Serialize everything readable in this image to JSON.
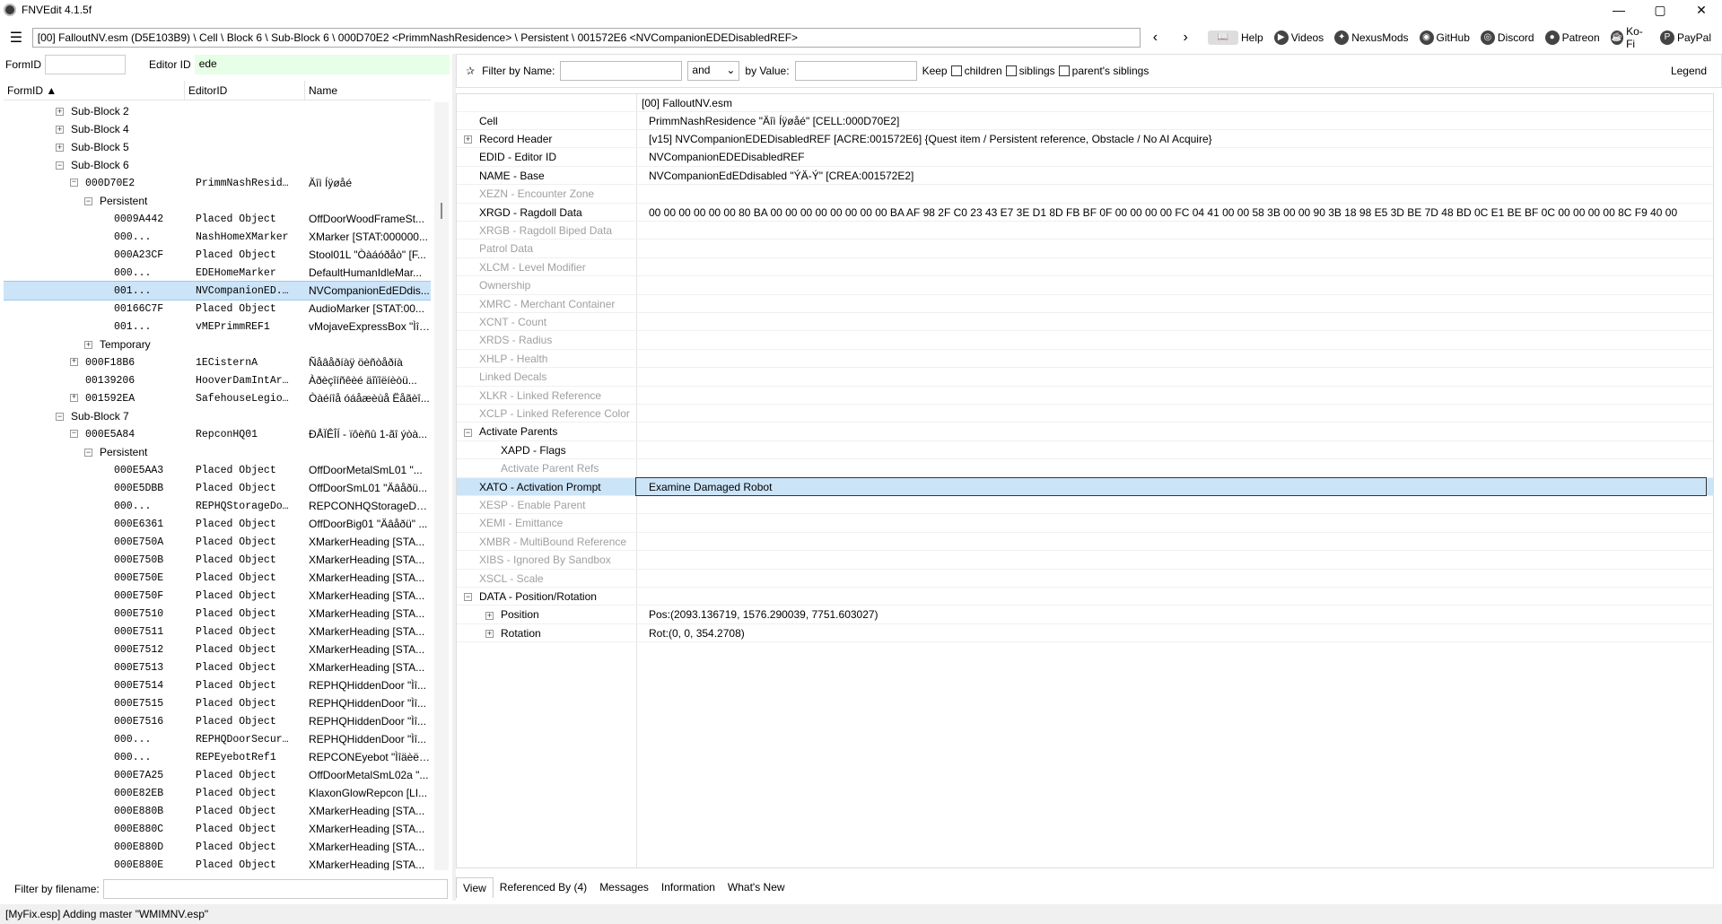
{
  "window": {
    "title": "FNVEdit 4.1.5f",
    "minimize": "—",
    "maximize": "▢",
    "close": "✕"
  },
  "toolbar": {
    "path": "[00] FalloutNV.esm (D5E103B9) \\ Cell \\ Block 6 \\ Sub-Block 6 \\ 000D70E2 <PrimmNashResidence> \\ Persistent \\ 001572E6 <NVCompanionEDEDisabledREF>",
    "back": "‹",
    "forward": "›",
    "links": [
      {
        "label": "Help",
        "icon": "book-icon"
      },
      {
        "label": "Videos",
        "icon": "videos-icon"
      },
      {
        "label": "NexusMods",
        "icon": "nexusmods-icon"
      },
      {
        "label": "GitHub",
        "icon": "github-icon"
      },
      {
        "label": "Discord",
        "icon": "discord-icon"
      },
      {
        "label": "Patreon",
        "icon": "patreon-icon"
      },
      {
        "label": "Ko-Fi",
        "icon": "kofi-icon"
      },
      {
        "label": "PayPal",
        "icon": "paypal-icon"
      }
    ]
  },
  "left": {
    "formid_label": "FormID",
    "editorid_label": "Editor ID",
    "editorid_value": "ede",
    "columns": [
      "FormID ▲",
      "EditorID",
      "Name"
    ],
    "filter_filename_label": "Filter by filename:",
    "tree": [
      {
        "indent": 0,
        "exp": "+",
        "form": "Sub-Block 2",
        "eid": "",
        "name": "",
        "mono": false
      },
      {
        "indent": 0,
        "exp": "+",
        "form": "Sub-Block 4",
        "eid": "",
        "name": "",
        "mono": false
      },
      {
        "indent": 0,
        "exp": "+",
        "form": "Sub-Block 5",
        "eid": "",
        "name": "",
        "mono": false
      },
      {
        "indent": 0,
        "exp": "−",
        "form": "Sub-Block 6",
        "eid": "",
        "name": "",
        "mono": false
      },
      {
        "indent": 1,
        "exp": "−",
        "form": "000D70E2",
        "eid": "PrimmNashReside...",
        "name": "Äîì Íÿøåé",
        "mono": true
      },
      {
        "indent": 2,
        "exp": "−",
        "form": "Persistent",
        "eid": "",
        "name": "",
        "mono": false
      },
      {
        "indent": 3,
        "exp": "",
        "form": "0009A442",
        "eid": "Placed Object",
        "name": "OffDoorWoodFrameSt...",
        "mono": true
      },
      {
        "indent": 3,
        "exp": "",
        "form": "000...",
        "eid": "NashHomeXMarker",
        "name": "XMarker [STAT:000000...",
        "mono": true
      },
      {
        "indent": 3,
        "exp": "",
        "form": "000A23CF",
        "eid": "Placed Object",
        "name": "Stool01L \"Òàáóðåò\" [F...",
        "mono": true
      },
      {
        "indent": 3,
        "exp": "",
        "form": "000...",
        "eid": "EDEHomeMarker",
        "name": "DefaultHumanIdleMar...",
        "mono": true
      },
      {
        "indent": 3,
        "exp": "",
        "form": "001...",
        "eid": "NVCompanionED...",
        "name": "NVCompanionEdEDdis...",
        "mono": true,
        "sel": true
      },
      {
        "indent": 3,
        "exp": "",
        "form": "00166C7F",
        "eid": "Placed Object",
        "name": "AudioMarker [STAT:00...",
        "mono": true
      },
      {
        "indent": 3,
        "exp": "",
        "form": "001...",
        "eid": "vMEPrimmREF1",
        "name": "vMojaveExpressBox \"Ìîõ...",
        "mono": true
      },
      {
        "indent": 2,
        "exp": "+",
        "form": "Temporary",
        "eid": "",
        "name": "",
        "mono": false
      },
      {
        "indent": 1,
        "exp": "+",
        "form": "000F18B6",
        "eid": "1ECisternA",
        "name": "Ñåâåðíàÿ öèñòåðíà",
        "mono": true
      },
      {
        "indent": 1,
        "exp": "",
        "form": "00139206",
        "eid": "HooverDamIntAriz...",
        "name": "Àðèçîíñêèé äîïîëíèòü...",
        "mono": true
      },
      {
        "indent": 1,
        "exp": "+",
        "form": "001592EA",
        "eid": "SafehouseLegionl...",
        "name": "Òàéíîå óáåæèùå Ëåãèî...",
        "mono": true
      },
      {
        "indent": 0,
        "exp": "−",
        "form": "Sub-Block 7",
        "eid": "",
        "name": "",
        "mono": false
      },
      {
        "indent": 1,
        "exp": "−",
        "form": "000E5A84",
        "eid": "RepconHQ01",
        "name": "ÐÅÏÊÎÍ - ïôèñû 1-ãî ýòà...",
        "mono": true
      },
      {
        "indent": 2,
        "exp": "−",
        "form": "Persistent",
        "eid": "",
        "name": "",
        "mono": false
      },
      {
        "indent": 3,
        "exp": "",
        "form": "000E5AA3",
        "eid": "Placed Object",
        "name": "OffDoorMetalSmL01 \"...",
        "mono": true
      },
      {
        "indent": 3,
        "exp": "",
        "form": "000E5DBB",
        "eid": "Placed Object",
        "name": "OffDoorSmL01 \"Äâåðü...",
        "mono": true
      },
      {
        "indent": 3,
        "exp": "",
        "form": "000...",
        "eid": "REPHQStorageDoor",
        "name": "REPCONHQStorageDo...",
        "mono": true
      },
      {
        "indent": 3,
        "exp": "",
        "form": "000E6361",
        "eid": "Placed Object",
        "name": "OffDoorBig01 \"Äâåðü\" ...",
        "mono": true
      },
      {
        "indent": 3,
        "exp": "",
        "form": "000E750A",
        "eid": "Placed Object",
        "name": "XMarkerHeading [STA...",
        "mono": true
      },
      {
        "indent": 3,
        "exp": "",
        "form": "000E750B",
        "eid": "Placed Object",
        "name": "XMarkerHeading [STA...",
        "mono": true
      },
      {
        "indent": 3,
        "exp": "",
        "form": "000E750E",
        "eid": "Placed Object",
        "name": "XMarkerHeading [STA...",
        "mono": true
      },
      {
        "indent": 3,
        "exp": "",
        "form": "000E750F",
        "eid": "Placed Object",
        "name": "XMarkerHeading [STA...",
        "mono": true
      },
      {
        "indent": 3,
        "exp": "",
        "form": "000E7510",
        "eid": "Placed Object",
        "name": "XMarkerHeading [STA...",
        "mono": true
      },
      {
        "indent": 3,
        "exp": "",
        "form": "000E7511",
        "eid": "Placed Object",
        "name": "XMarkerHeading [STA...",
        "mono": true
      },
      {
        "indent": 3,
        "exp": "",
        "form": "000E7512",
        "eid": "Placed Object",
        "name": "XMarkerHeading [STA...",
        "mono": true
      },
      {
        "indent": 3,
        "exp": "",
        "form": "000E7513",
        "eid": "Placed Object",
        "name": "XMarkerHeading [STA...",
        "mono": true
      },
      {
        "indent": 3,
        "exp": "",
        "form": "000E7514",
        "eid": "Placed Object",
        "name": "REPHQHiddenDoor \"Ìî...",
        "mono": true
      },
      {
        "indent": 3,
        "exp": "",
        "form": "000E7515",
        "eid": "Placed Object",
        "name": "REPHQHiddenDoor \"Ìî...",
        "mono": true
      },
      {
        "indent": 3,
        "exp": "",
        "form": "000E7516",
        "eid": "Placed Object",
        "name": "REPHQHiddenDoor \"Ìî...",
        "mono": true
      },
      {
        "indent": 3,
        "exp": "",
        "form": "000...",
        "eid": "REPHQDoorSecurity",
        "name": "REPHQHiddenDoor \"Ìî...",
        "mono": true
      },
      {
        "indent": 3,
        "exp": "",
        "form": "000...",
        "eid": "REPEyebotRef1",
        "name": "REPCONEyebot \"Ìîäèëü...",
        "mono": true
      },
      {
        "indent": 3,
        "exp": "",
        "form": "000E7A25",
        "eid": "Placed Object",
        "name": "OffDoorMetalSmL02a \"...",
        "mono": true
      },
      {
        "indent": 3,
        "exp": "",
        "form": "000E82EB",
        "eid": "Placed Object",
        "name": "KlaxonGlowRepcon [LI...",
        "mono": true
      },
      {
        "indent": 3,
        "exp": "",
        "form": "000E880B",
        "eid": "Placed Object",
        "name": "XMarkerHeading [STA...",
        "mono": true
      },
      {
        "indent": 3,
        "exp": "",
        "form": "000E880C",
        "eid": "Placed Object",
        "name": "XMarkerHeading [STA...",
        "mono": true
      },
      {
        "indent": 3,
        "exp": "",
        "form": "000E880D",
        "eid": "Placed Object",
        "name": "XMarkerHeading [STA...",
        "mono": true
      },
      {
        "indent": 3,
        "exp": "",
        "form": "000E880E",
        "eid": "Placed Object",
        "name": "XMarkerHeading [STA...",
        "mono": true
      }
    ]
  },
  "right": {
    "filter_name_label": "Filter by Name:",
    "and_label": "and",
    "by_value_label": "by Value:",
    "keep_label": "Keep",
    "children_label": "children",
    "siblings_label": "siblings",
    "parents_siblings_label": "parent's siblings",
    "legend_label": "Legend",
    "header_value": "[00] FalloutNV.esm",
    "rows": [
      {
        "label": "Cell",
        "value": "PrimmNashResidence \"Äîì Íÿøåé\" [CELL:000D70E2]",
        "indent": 0,
        "exp": "",
        "gray": false
      },
      {
        "label": "Record Header",
        "value": "[v15] NVCompanionEDEDisabledREF [ACRE:001572E6] {Quest item / Persistent reference, Obstacle / No AI Acquire}",
        "indent": 0,
        "exp": "+",
        "gray": false
      },
      {
        "label": "EDID - Editor ID",
        "value": "NVCompanionEDEDisabledREF",
        "indent": 0,
        "exp": "",
        "gray": false
      },
      {
        "label": "NAME - Base",
        "value": "NVCompanionEdEDdisabled \"ÝÄ-Ý\" [CREA:001572E2]",
        "indent": 0,
        "exp": "",
        "gray": false
      },
      {
        "label": "XEZN - Encounter Zone",
        "value": "",
        "indent": 0,
        "exp": "",
        "gray": true
      },
      {
        "label": "XRGD - Ragdoll Data",
        "value": "00 00 00 00 00 00 80 BA 00 00 00 00 00 00 00 00 BA AF 98 2F C0 23 43 E7 3E D1 8D FB BF 0F 00 00 00 00 FC 04 41 00 00 58 3B 00 00 90 3B 18 98 E5 3D BE 7D 48 BD 0C E1 BE BF 0C 00 00 00 00 8C F9 40 00 00 E8 3B 00 00 60 BC 58 C0 ...",
        "indent": 0,
        "exp": "",
        "gray": false
      },
      {
        "label": "XRGB - Ragdoll Biped Data",
        "value": "",
        "indent": 0,
        "exp": "",
        "gray": true
      },
      {
        "label": "Patrol Data",
        "value": "",
        "indent": 0,
        "exp": "",
        "gray": true
      },
      {
        "label": "XLCM - Level Modifier",
        "value": "",
        "indent": 0,
        "exp": "",
        "gray": true
      },
      {
        "label": "Ownership",
        "value": "",
        "indent": 0,
        "exp": "",
        "gray": true
      },
      {
        "label": "XMRC - Merchant Container",
        "value": "",
        "indent": 0,
        "exp": "",
        "gray": true
      },
      {
        "label": "XCNT - Count",
        "value": "",
        "indent": 0,
        "exp": "",
        "gray": true
      },
      {
        "label": "XRDS - Radius",
        "value": "",
        "indent": 0,
        "exp": "",
        "gray": true
      },
      {
        "label": "XHLP - Health",
        "value": "",
        "indent": 0,
        "exp": "",
        "gray": true
      },
      {
        "label": "Linked Decals",
        "value": "",
        "indent": 0,
        "exp": "",
        "gray": true
      },
      {
        "label": "XLKR - Linked Reference",
        "value": "",
        "indent": 0,
        "exp": "",
        "gray": true
      },
      {
        "label": "XCLP - Linked Reference Color",
        "value": "",
        "indent": 0,
        "exp": "",
        "gray": true
      },
      {
        "label": "Activate Parents",
        "value": "",
        "indent": 0,
        "exp": "−",
        "gray": false
      },
      {
        "label": "XAPD - Flags",
        "value": "",
        "indent": 1,
        "exp": "",
        "gray": false
      },
      {
        "label": "Activate Parent Refs",
        "value": "",
        "indent": 1,
        "exp": "",
        "gray": true
      },
      {
        "label": "XATO - Activation Prompt",
        "value": "Examine Damaged Robot",
        "indent": 0,
        "exp": "",
        "gray": false,
        "sel": true
      },
      {
        "label": "XESP - Enable Parent",
        "value": "",
        "indent": 0,
        "exp": "",
        "gray": true
      },
      {
        "label": "XEMI - Emittance",
        "value": "",
        "indent": 0,
        "exp": "",
        "gray": true
      },
      {
        "label": "XMBR - MultiBound Reference",
        "value": "",
        "indent": 0,
        "exp": "",
        "gray": true
      },
      {
        "label": "XIBS - Ignored By Sandbox",
        "value": "",
        "indent": 0,
        "exp": "",
        "gray": true
      },
      {
        "label": "XSCL - Scale",
        "value": "",
        "indent": 0,
        "exp": "",
        "gray": true
      },
      {
        "label": "DATA - Position/Rotation",
        "value": "",
        "indent": 0,
        "exp": "−",
        "gray": false
      },
      {
        "label": "Position",
        "value": "Pos:(2093.136719, 1576.290039, 7751.603027)",
        "indent": 1,
        "exp": "+",
        "gray": false
      },
      {
        "label": "Rotation",
        "value": "Rot:(0, 0, 354.2708)",
        "indent": 1,
        "exp": "+",
        "gray": false
      }
    ],
    "tabs": [
      "View",
      "Referenced By (4)",
      "Messages",
      "Information",
      "What's New"
    ]
  },
  "status": "[MyFix.esp] Adding master \"WMIMNV.esp\""
}
